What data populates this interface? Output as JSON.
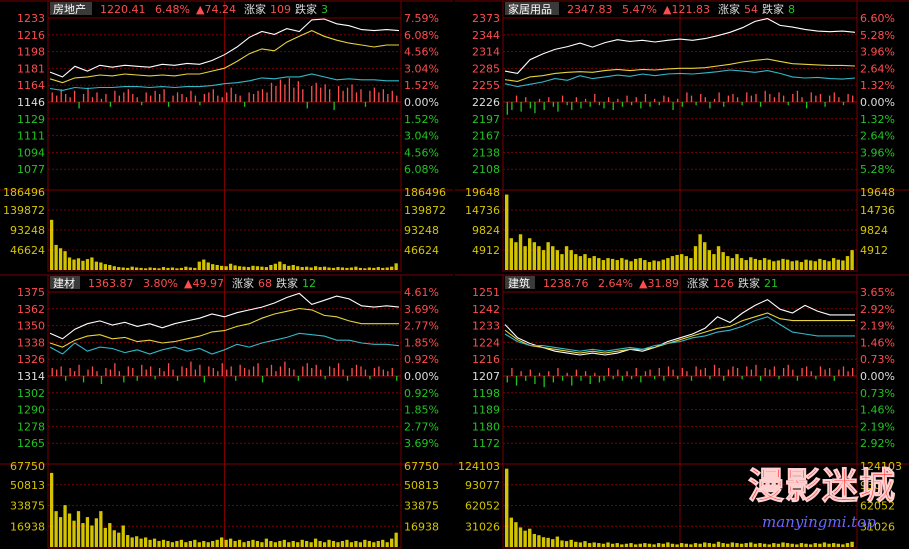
{
  "colors": {
    "background": "#000000",
    "grid": "#7a0000",
    "white_line": "#ffffff",
    "yellow_line": "#e8d23a",
    "cyan_line": "#32b8c8",
    "up": "#ff4d4d",
    "down": "#22c422",
    "volume": "#d4c400",
    "label_red": "#ff4d4d",
    "label_green": "#22c422",
    "label_white": "#dddddd",
    "title_bg": "#3a3a3a"
  },
  "chart_data": [
    {
      "type": "line",
      "name": "房地产",
      "header": {
        "name": "房地产",
        "last": "1220.41",
        "pct": "6.48%",
        "change": "▲74.24",
        "up_label": "涨家",
        "up_count": "109",
        "down_label": "跌家",
        "down_count": "3"
      },
      "price_ticks_up": [
        "1233",
        "1216",
        "1198",
        "1181",
        "1164"
      ],
      "price_base": "1146",
      "price_ticks_down": [
        "1129",
        "1111",
        "1094",
        "1077"
      ],
      "pct_ticks_up": [
        "7.59%",
        "6.08%",
        "4.56%",
        "3.04%",
        "1.52%"
      ],
      "pct_base": "0.00%",
      "pct_ticks_down": [
        "1.52%",
        "3.04%",
        "4.56%",
        "6.08%"
      ],
      "volume_ticks": [
        "186496",
        "139872",
        "93248",
        "46624"
      ],
      "ylim": [
        1077,
        1233
      ],
      "vol_max": 186496,
      "series": [
        {
          "color_key": "white_line",
          "values": [
            1177,
            1172,
            1183,
            1178,
            1184,
            1182,
            1184,
            1183,
            1182,
            1185,
            1184,
            1186,
            1185,
            1189,
            1195,
            1203,
            1213,
            1219,
            1216,
            1222,
            1219,
            1231,
            1232,
            1227,
            1225,
            1221,
            1220,
            1221,
            1220
          ]
        },
        {
          "color_key": "yellow_line",
          "values": [
            1170,
            1166,
            1171,
            1172,
            1174,
            1173,
            1175,
            1174,
            1173,
            1174,
            1173,
            1175,
            1175,
            1178,
            1181,
            1188,
            1196,
            1201,
            1199,
            1208,
            1214,
            1220,
            1214,
            1210,
            1207,
            1205,
            1203,
            1205,
            1205
          ]
        },
        {
          "color_key": "cyan_line",
          "values": [
            1160,
            1158,
            1161,
            1160,
            1161,
            1161,
            1162,
            1162,
            1161,
            1162,
            1161,
            1162,
            1162,
            1163,
            1165,
            1166,
            1168,
            1171,
            1170,
            1172,
            1172,
            1175,
            1172,
            1169,
            1170,
            1169,
            1169,
            1168,
            1168
          ]
        }
      ],
      "bars": [
        6,
        4,
        8,
        5,
        3,
        7,
        -4,
        5,
        9,
        3,
        6,
        2,
        5,
        -3,
        7,
        4,
        6,
        8,
        5,
        3,
        -2,
        6,
        4,
        7,
        5,
        8,
        -3,
        4,
        6,
        5,
        3,
        7,
        4,
        -2,
        5,
        6,
        8,
        4,
        3,
        6,
        9,
        5,
        4,
        -3,
        6,
        5,
        7,
        8,
        6,
        12,
        10,
        14,
        11,
        15,
        9,
        13,
        8,
        -4,
        10,
        12,
        9,
        11,
        8,
        -5,
        10,
        7,
        9,
        11,
        6,
        8,
        -3,
        7,
        9,
        6,
        8,
        5,
        7,
        4
      ],
      "volume": [
        120000,
        60000,
        52000,
        45000,
        30000,
        25000,
        28000,
        22000,
        26000,
        30000,
        20000,
        18000,
        14000,
        12000,
        9000,
        7000,
        6000,
        5000,
        8000,
        6000,
        5000,
        4000,
        6000,
        5000,
        4000,
        7000,
        5000,
        6000,
        4000,
        5000,
        8000,
        6000,
        5000,
        20000,
        25000,
        18000,
        14000,
        12000,
        10000,
        9000,
        15000,
        11000,
        9000,
        8000,
        7000,
        10000,
        9000,
        8000,
        7000,
        12000,
        15000,
        20000,
        14000,
        10000,
        12000,
        9000,
        7000,
        8000,
        6000,
        9000,
        7000,
        8000,
        6000,
        5000,
        7000,
        6000,
        5000,
        6000,
        8000,
        5000,
        4000,
        6000,
        5000,
        7000,
        5000,
        6000,
        8000,
        16000
      ]
    },
    {
      "type": "line",
      "name": "家居用品",
      "header": {
        "name": "家居用品",
        "last": "2347.83",
        "pct": "5.47%",
        "change": "▲121.83",
        "up_label": "涨家",
        "up_count": "54",
        "down_label": "跌家",
        "down_count": "8"
      },
      "price_ticks_up": [
        "2373",
        "2344",
        "2314",
        "2285",
        "2255"
      ],
      "price_base": "2226",
      "price_ticks_down": [
        "2197",
        "2167",
        "2138",
        "2108"
      ],
      "pct_ticks_up": [
        "6.60%",
        "5.28%",
        "3.96%",
        "2.64%",
        "1.32%"
      ],
      "pct_base": "0.00%",
      "pct_ticks_down": [
        "1.32%",
        "2.64%",
        "3.96%",
        "5.28%"
      ],
      "volume_ticks": [
        "19648",
        "14736",
        "9824",
        "4912"
      ],
      "ylim": [
        2108,
        2373
      ],
      "vol_max": 19648,
      "series": [
        {
          "color_key": "white_line",
          "values": [
            2280,
            2276,
            2300,
            2310,
            2318,
            2323,
            2329,
            2322,
            2330,
            2335,
            2332,
            2334,
            2331,
            2334,
            2336,
            2334,
            2337,
            2342,
            2348,
            2356,
            2367,
            2372,
            2360,
            2357,
            2353,
            2350,
            2349,
            2350,
            2348
          ]
        },
        {
          "color_key": "yellow_line",
          "values": [
            2265,
            2262,
            2270,
            2272,
            2276,
            2278,
            2279,
            2278,
            2281,
            2283,
            2281,
            2283,
            2282,
            2284,
            2285,
            2285,
            2286,
            2289,
            2292,
            2296,
            2299,
            2301,
            2297,
            2293,
            2292,
            2291,
            2290,
            2290,
            2289
          ]
        },
        {
          "color_key": "cyan_line",
          "values": [
            2258,
            2253,
            2257,
            2261,
            2267,
            2264,
            2272,
            2267,
            2270,
            2273,
            2271,
            2275,
            2272,
            2275,
            2276,
            2275,
            2277,
            2279,
            2282,
            2280,
            2278,
            2281,
            2276,
            2270,
            2268,
            2269,
            2267,
            2266,
            2268
          ]
        }
      ],
      "bars": [
        -8,
        -5,
        4,
        -6,
        3,
        -4,
        -7,
        2,
        -5,
        3,
        -3,
        -6,
        4,
        -2,
        -5,
        3,
        -4,
        2,
        -3,
        5,
        -2,
        -4,
        3,
        -5,
        2,
        -3,
        4,
        -2,
        3,
        -4,
        5,
        -3,
        2,
        -2,
        4,
        3,
        -5,
        2,
        -3,
        6,
        4,
        -2,
        5,
        3,
        -4,
        2,
        6,
        -3,
        4,
        5,
        3,
        -2,
        6,
        4,
        5,
        -3,
        7,
        5,
        3,
        6,
        4,
        -2,
        5,
        7,
        3,
        -4,
        6,
        4,
        5,
        -3,
        4,
        6,
        3,
        -2,
        5,
        4
      ],
      "volume": [
        19000,
        8000,
        7000,
        9000,
        6000,
        8000,
        7000,
        6000,
        5000,
        7000,
        6000,
        5000,
        4000,
        6000,
        5000,
        4000,
        3500,
        4000,
        3000,
        3500,
        3000,
        2500,
        3000,
        2800,
        2500,
        3000,
        2600,
        2200,
        2800,
        3000,
        2500,
        2000,
        2400,
        2200,
        2600,
        3000,
        3500,
        3800,
        4000,
        3500,
        3000,
        6000,
        9000,
        7000,
        5000,
        4000,
        6000,
        4500,
        3500,
        3000,
        4000,
        3000,
        2500,
        3200,
        2800,
        2500,
        3000,
        2600,
        2200,
        2400,
        2800,
        2600,
        2200,
        2400,
        2000,
        2600,
        2400,
        2200,
        2800,
        2500,
        2200,
        3000,
        2600,
        2400,
        3500,
        5000
      ]
    },
    {
      "type": "line",
      "name": "建材",
      "header": {
        "name": "建材",
        "last": "1363.87",
        "pct": "3.80%",
        "change": "▲49.97",
        "up_label": "涨家",
        "up_count": "68",
        "down_label": "跌家",
        "down_count": "12"
      },
      "price_ticks_up": [
        "1375",
        "1362",
        "1350",
        "1338",
        "1326"
      ],
      "price_base": "1314",
      "price_ticks_down": [
        "1302",
        "1290",
        "1278",
        "1265"
      ],
      "pct_ticks_up": [
        "4.61%",
        "3.69%",
        "2.77%",
        "1.85%",
        "0.92%"
      ],
      "pct_base": "0.00%",
      "pct_ticks_down": [
        "0.92%",
        "1.85%",
        "2.77%",
        "3.69%"
      ],
      "volume_ticks": [
        "67750",
        "50813",
        "33875",
        "16938"
      ],
      "ylim": [
        1265,
        1375
      ],
      "vol_max": 67750,
      "series": [
        {
          "color_key": "white_line",
          "values": [
            1345,
            1341,
            1348,
            1352,
            1354,
            1351,
            1353,
            1350,
            1352,
            1349,
            1352,
            1354,
            1356,
            1359,
            1357,
            1360,
            1362,
            1364,
            1367,
            1371,
            1374,
            1366,
            1369,
            1372,
            1370,
            1365,
            1364,
            1365,
            1364
          ]
        },
        {
          "color_key": "yellow_line",
          "values": [
            1338,
            1335,
            1340,
            1343,
            1344,
            1341,
            1342,
            1339,
            1340,
            1338,
            1339,
            1341,
            1343,
            1346,
            1347,
            1350,
            1352,
            1356,
            1359,
            1361,
            1363,
            1362,
            1358,
            1357,
            1354,
            1352,
            1352,
            1352,
            1352
          ]
        },
        {
          "color_key": "cyan_line",
          "values": [
            1335,
            1330,
            1338,
            1332,
            1335,
            1334,
            1331,
            1333,
            1330,
            1333,
            1335,
            1332,
            1334,
            1330,
            1333,
            1337,
            1335,
            1338,
            1340,
            1342,
            1345,
            1344,
            1343,
            1340,
            1340,
            1338,
            1337,
            1337,
            1336
          ]
        }
      ],
      "bars": [
        5,
        4,
        6,
        -3,
        5,
        3,
        7,
        -4,
        4,
        6,
        3,
        -5,
        5,
        4,
        8,
        3,
        -4,
        6,
        5,
        -3,
        7,
        4,
        6,
        -2,
        5,
        3,
        8,
        4,
        -3,
        6,
        5,
        9,
        4,
        7,
        -4,
        6,
        5,
        3,
        8,
        4,
        6,
        -3,
        7,
        5,
        4,
        6,
        8,
        -4,
        5,
        7,
        3,
        6,
        9,
        5,
        4,
        -3,
        6,
        8,
        5,
        7,
        4,
        -2,
        6,
        5,
        8,
        4,
        -3,
        5,
        7,
        6,
        4,
        -2,
        5,
        6,
        4,
        3,
        5,
        -3
      ],
      "volume": [
        62000,
        30000,
        25000,
        35000,
        28000,
        22000,
        30000,
        20000,
        25000,
        18000,
        24000,
        30000,
        16000,
        20000,
        14000,
        12000,
        18000,
        10000,
        8000,
        9000,
        7000,
        8000,
        6000,
        7000,
        5000,
        6000,
        5000,
        4000,
        5000,
        6000,
        4000,
        5000,
        6000,
        4000,
        5000,
        4000,
        5000,
        6000,
        8000,
        6000,
        7000,
        5000,
        6000,
        4000,
        5000,
        6000,
        5000,
        4000,
        7000,
        5000,
        4000,
        5000,
        6000,
        4000,
        5000,
        4000,
        6000,
        5000,
        4000,
        7000,
        5000,
        4000,
        6000,
        5000,
        4000,
        5000,
        6000,
        4000,
        5000,
        4000,
        6000,
        5000,
        4000,
        5000,
        6000,
        4000,
        7000,
        12000
      ]
    },
    {
      "type": "line",
      "name": "建筑",
      "header": {
        "name": "建筑",
        "last": "1238.76",
        "pct": "2.64%",
        "change": "▲31.89",
        "up_label": "涨家",
        "up_count": "126",
        "down_label": "跌家",
        "down_count": "21"
      },
      "price_ticks_up": [
        "1251",
        "1242",
        "1233",
        "1224",
        "1216"
      ],
      "price_base": "1207",
      "price_ticks_down": [
        "1198",
        "1189",
        "1180",
        "1172"
      ],
      "pct_ticks_up": [
        "3.65%",
        "2.92%",
        "2.19%",
        "1.46%",
        "0.73%"
      ],
      "pct_base": "0.00%",
      "pct_ticks_down": [
        "0.73%",
        "1.46%",
        "2.19%",
        "2.92%"
      ],
      "volume_ticks": [
        "124103",
        "93077",
        "62052",
        "31026"
      ],
      "ylim": [
        1172,
        1251
      ],
      "vol_max": 124103,
      "series": [
        {
          "color_key": "white_line",
          "values": [
            1234,
            1227,
            1224,
            1222,
            1220,
            1219,
            1218,
            1219,
            1218,
            1219,
            1221,
            1220,
            1222,
            1225,
            1227,
            1229,
            1232,
            1238,
            1235,
            1240,
            1244,
            1247,
            1242,
            1240,
            1244,
            1241,
            1239,
            1239,
            1239
          ]
        },
        {
          "color_key": "yellow_line",
          "values": [
            1231,
            1226,
            1223,
            1222,
            1221,
            1220,
            1219,
            1220,
            1219,
            1220,
            1221,
            1221,
            1222,
            1224,
            1226,
            1228,
            1230,
            1232,
            1233,
            1236,
            1238,
            1240,
            1237,
            1236,
            1236,
            1236,
            1236,
            1236,
            1236
          ]
        },
        {
          "color_key": "cyan_line",
          "values": [
            1229,
            1225,
            1223,
            1223,
            1222,
            1221,
            1220,
            1221,
            1220,
            1221,
            1222,
            1221,
            1223,
            1224,
            1225,
            1227,
            1228,
            1230,
            1231,
            1233,
            1236,
            1238,
            1234,
            1230,
            1229,
            1228,
            1228,
            1228,
            1228
          ]
        }
      ],
      "bars": [
        -4,
        5,
        -6,
        3,
        -3,
        4,
        -5,
        2,
        -7,
        3,
        -4,
        5,
        -3,
        2,
        -6,
        4,
        -3,
        3,
        -5,
        2,
        -4,
        -3,
        5,
        -2,
        4,
        -3,
        3,
        -2,
        5,
        -4,
        3,
        4,
        -2,
        5,
        -3,
        6,
        4,
        -2,
        5,
        3,
        -3,
        6,
        4,
        5,
        -2,
        7,
        5,
        -3,
        4,
        6,
        5,
        -2,
        6,
        4,
        7,
        -3,
        5,
        4,
        6,
        -2,
        5,
        7,
        4,
        -3,
        5,
        6,
        3,
        -2,
        6,
        4,
        5,
        -3,
        4,
        6,
        3,
        5
      ],
      "volume": [
        120000,
        45000,
        38000,
        30000,
        25000,
        28000,
        20000,
        18000,
        15000,
        14000,
        12000,
        16000,
        10000,
        9000,
        11000,
        8000,
        7000,
        9000,
        6000,
        7000,
        6000,
        5000,
        7000,
        5000,
        6000,
        4000,
        5000,
        6000,
        4000,
        5000,
        6000,
        5000,
        4000,
        6000,
        5000,
        7000,
        5000,
        4000,
        6000,
        5000,
        4000,
        6000,
        5000,
        7000,
        6000,
        5000,
        8000,
        6000,
        5000,
        7000,
        6000,
        5000,
        6000,
        7000,
        5000,
        6000,
        5000,
        4000,
        6000,
        5000,
        7000,
        6000,
        5000,
        4000,
        6000,
        5000,
        4000,
        6000,
        5000,
        7000,
        5000,
        6000,
        5000,
        4000,
        6000,
        8000
      ]
    }
  ],
  "watermark": {
    "main": "漫影迷城",
    "url": "manyingmi.top"
  }
}
